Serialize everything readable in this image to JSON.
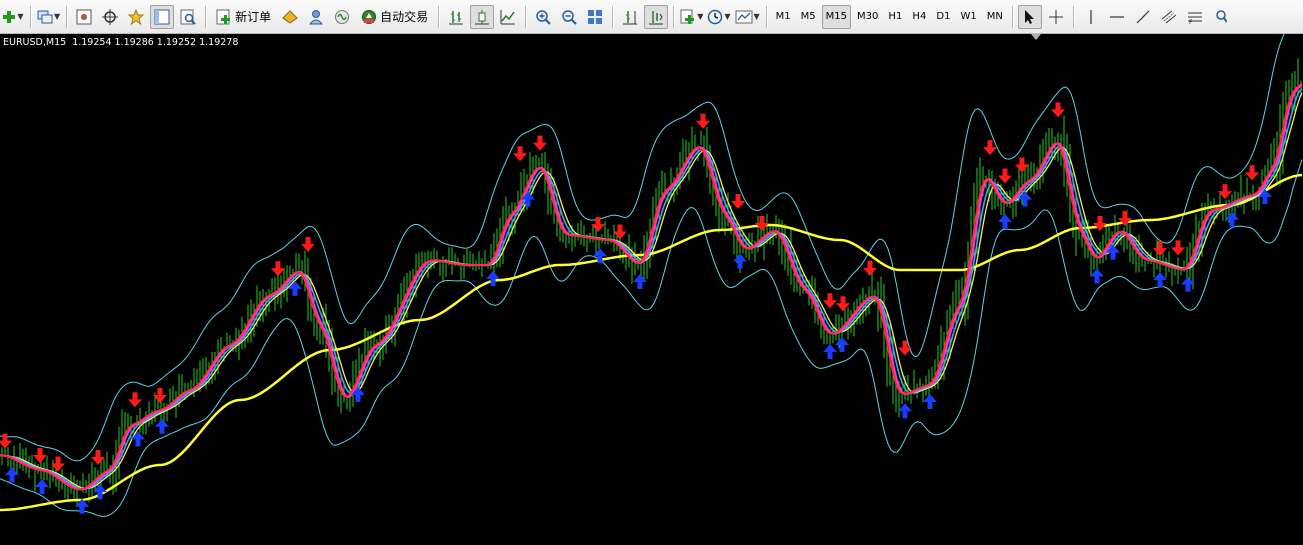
{
  "toolbar": {
    "new_order_label": "新订单",
    "auto_trade_label": "自动交易",
    "timeframes": [
      "M1",
      "M5",
      "M15",
      "M30",
      "H1",
      "H4",
      "D1",
      "W1",
      "MN"
    ],
    "active_timeframe": "M15"
  },
  "chart": {
    "symbol_header": "EURUSD,M15  1.19254 1.19286 1.19252 1.19278",
    "colors": {
      "background": "#000000",
      "bars": "#22cc22",
      "bollinger": "#5fd3e6",
      "ma_long": "#ffff33",
      "ma_fast_yellow": "#ffee55",
      "ma_red": "#ff2a2a",
      "ma_magenta": "#ff33cc",
      "ma_blue": "#33a8ff",
      "sell_arrow": "#ff1a1a",
      "buy_arrow": "#1a3cff"
    }
  }
}
